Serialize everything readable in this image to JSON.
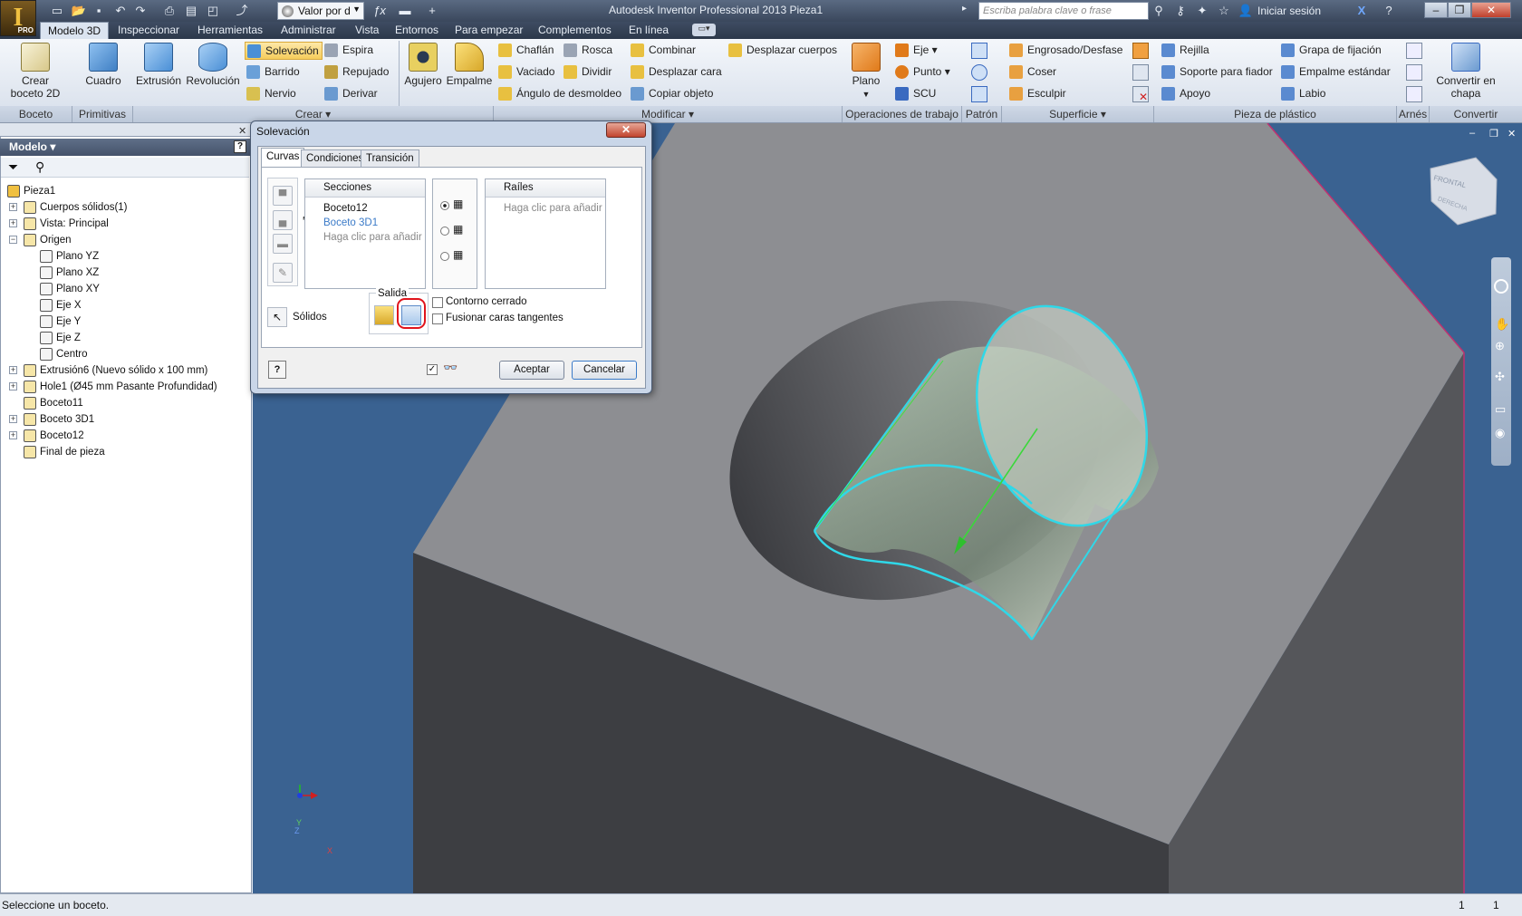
{
  "window": {
    "title": "Autodesk Inventor Professional 2013    Pieza1",
    "app_badge": "PRO",
    "style_value": "Valor por d",
    "search_placeholder": "Escriba palabra clave o frase",
    "signin": "Iniciar sesión"
  },
  "menu_tabs": [
    "Modelo 3D",
    "Inspeccionar",
    "Herramientas",
    "Administrar",
    "Vista",
    "Entornos",
    "Para empezar",
    "Complementos",
    "En línea"
  ],
  "ribbon": {
    "boceto": {
      "crear_boceto": "Crear\nboceto 2D",
      "label": "Boceto"
    },
    "primitivas": {
      "cuadro": "Cuadro",
      "label": "Primitivas"
    },
    "crear": {
      "extrusion": "Extrusión",
      "revolucion": "Revolución",
      "solevacion": "Solevación",
      "barrido": "Barrido",
      "nervio": "Nervio",
      "espira": "Espira",
      "repujado": "Repujado",
      "derivar": "Derivar",
      "agujero": "Agujero",
      "empalme": "Empalme",
      "label": "Crear"
    },
    "modificar": {
      "chaflan": "Chaflán",
      "vaciado": "Vaciado",
      "angulo": "Ángulo de desmoldeo",
      "rosca": "Rosca",
      "dividir": "Dividir",
      "combinar": "Combinar",
      "desplazar_cara": "Desplazar cara",
      "copiar_objeto": "Copiar objeto",
      "desplazar_cuerpos": "Desplazar cuerpos",
      "label": "Modificar"
    },
    "operaciones": {
      "plano": "Plano",
      "eje": "Eje",
      "punto": "Punto",
      "scu": "SCU",
      "label": "Operaciones de trabajo"
    },
    "patron": {
      "label": "Patrón"
    },
    "superficie": {
      "engrosado": "Engrosado/Desfase",
      "coser": "Coser",
      "esculpir": "Esculpir",
      "label": "Superficie"
    },
    "plastico": {
      "rejilla": "Rejilla",
      "soporte": "Soporte para fiador",
      "apoyo": "Apoyo",
      "grapa": "Grapa de fijación",
      "empalme_estandar": "Empalme estándar",
      "labio": "Labio",
      "label": "Pieza de plástico"
    },
    "arnes": {
      "label": "Arnés"
    },
    "convertir": {
      "btn": "Convertir en\nchapa",
      "label": "Convertir"
    }
  },
  "browser": {
    "title": "Modelo",
    "items": [
      {
        "label": "Pieza1",
        "level": 0,
        "expander": ""
      },
      {
        "label": "Cuerpos sólidos(1)",
        "level": 1,
        "expander": "+"
      },
      {
        "label": "Vista: Principal",
        "level": 1,
        "expander": "+"
      },
      {
        "label": "Origen",
        "level": 1,
        "expander": "−"
      },
      {
        "label": "Plano YZ",
        "level": 2,
        "expander": ""
      },
      {
        "label": "Plano XZ",
        "level": 2,
        "expander": ""
      },
      {
        "label": "Plano XY",
        "level": 2,
        "expander": ""
      },
      {
        "label": "Eje X",
        "level": 2,
        "expander": ""
      },
      {
        "label": "Eje Y",
        "level": 2,
        "expander": ""
      },
      {
        "label": "Eje Z",
        "level": 2,
        "expander": ""
      },
      {
        "label": "Centro",
        "level": 2,
        "expander": ""
      },
      {
        "label": "Extrusión6 (Nuevo sólido x 100 mm)",
        "level": 1,
        "expander": "+"
      },
      {
        "label": "Hole1 (Ø45 mm Pasante Profundidad)",
        "level": 1,
        "expander": "+"
      },
      {
        "label": "Boceto11",
        "level": 1,
        "expander": ""
      },
      {
        "label": "Boceto 3D1",
        "level": 1,
        "expander": "+"
      },
      {
        "label": "Boceto12",
        "level": 1,
        "expander": "+"
      },
      {
        "label": "Final de pieza",
        "level": 1,
        "expander": ""
      }
    ]
  },
  "dialog": {
    "title": "Solevación",
    "tabs": [
      "Curvas",
      "Condiciones",
      "Transición"
    ],
    "secciones_header": "Secciones",
    "secciones": [
      "Boceto12",
      "Boceto 3D1",
      "Haga clic para añadir"
    ],
    "railes_header": "Raíles",
    "railes_placeholder": "Haga clic para añadir",
    "solidos": "Sólidos",
    "salida": "Salida",
    "contorno_cerrado": "Contorno cerrado",
    "fusionar": "Fusionar caras tangentes",
    "aceptar": "Aceptar",
    "cancelar": "Cancelar"
  },
  "viewcube": {
    "front": "FRONTAL",
    "right": "DERECHA"
  },
  "status": {
    "message": "Seleccione un boceto.",
    "count1": "1",
    "count2": "1"
  },
  "colors": {
    "viewport": "#3a6291",
    "highlight": "#2fd8e8",
    "selection_ring": "#e0141c"
  }
}
